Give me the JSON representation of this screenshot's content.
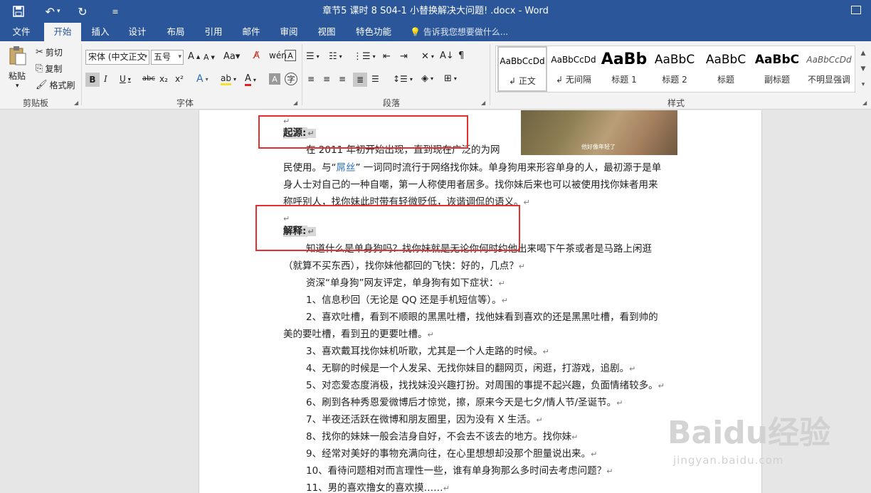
{
  "window": {
    "title": "章节5 课时 8 S04-1 小替换解决大问题! .docx - Word"
  },
  "quick_access": {
    "save_icon": "save-icon",
    "undo_icon": "undo-icon",
    "redo_icon": "redo-icon",
    "customize_icon": "customize-icon"
  },
  "tabs": [
    "文件",
    "开始",
    "插入",
    "设计",
    "布局",
    "引用",
    "邮件",
    "审阅",
    "视图",
    "特色功能"
  ],
  "tell_me": "告诉我您想要做什么...",
  "clipboard": {
    "paste": "粘贴",
    "cut": "剪切",
    "copy": "复制",
    "format_painter": "格式刷",
    "group_label": "剪贴板"
  },
  "font": {
    "font_name": "宋体 (中文正文",
    "font_size": "五号",
    "group_label": "字体"
  },
  "paragraph": {
    "group_label": "段落"
  },
  "styles": {
    "group_label": "样式",
    "items": [
      {
        "sample": "AaBbCcDd",
        "name": "正文"
      },
      {
        "sample": "AaBbCcDd",
        "name": "无间隔"
      },
      {
        "sample": "AaBb",
        "name": "标题 1"
      },
      {
        "sample": "AaBbC",
        "name": "标题 2"
      },
      {
        "sample": "AaBbC",
        "name": "标题"
      },
      {
        "sample": "AaBbC",
        "name": "副标题"
      },
      {
        "sample": "AaBbCcDd",
        "name": "不明显强调"
      }
    ]
  },
  "image": {
    "caption": "他好像年轻了"
  },
  "document": {
    "para_mark": "↵",
    "origin_heading": "起源:",
    "origin_p1": "在 2011 年初开始出现，直到现在广泛的为网",
    "origin_p2_a": "民使用。与“",
    "origin_p2_link": "屌丝",
    "origin_p2_b": "” 一词同时流行于网络找你妹。单身狗用来形容单身的人，最初源于是单",
    "origin_p3": "身人士对自己的一种自嘲，第一人称使用者居多。找你妹后来也可以被使用找你妹者用来",
    "origin_p4": "称呼别人，找你妹此时带有轻微贬低，诙谐调侃的语义。",
    "explain_heading": "解释:",
    "explain_p1": "知道什么是单身狗吗？找你妹就是无论你何时约他出来喝下午茶或者是马路上闲逛",
    "explain_p2": "（就算不买东西），找你妹他都回的飞快：好的，几点？",
    "explain_p3": "资深“单身狗”网友评定，单身狗有如下症状：",
    "items": [
      "1、信息秒回（无论是 QQ 还是手机短信等）。",
      "2、喜欢吐槽，看到不顺眼的黑黑吐槽，找他妹看到喜欢的还是黑黑吐槽，看到帅的",
      "3、喜欢戴耳找你妹机听歌，尤其是一个人走路的时候。",
      "4、无聊的时候是一个人发呆、无找你妹目的翻网页，闲逛，打游戏，追剧。",
      "5、对恋爱态度消极，找找妹没兴趣打扮。对周围的事提不起兴趣，负面情绪较多。",
      "6、刷到各种秀恩爱微博后才惊觉，擦，原来今天是七夕/情人节/圣诞节。",
      "7、半夜还活跃在微博和朋友圈里，因为没有 X 生活。",
      "8、找你的妹妹一般会洁身自好，不会去不该去的地方。找你妹",
      "9、经常对美好的事物充满向往，在心里想想却没那个胆量说出来。",
      "10、看待问题相对而言理性一些，谁有单身狗那么多时间去考虑问题？",
      "11、男的喜欢撸女的喜欢摸……"
    ],
    "item2_cont": "美的要吐槽，看到丑的更要吐槽。"
  },
  "watermark": {
    "main": "Baidu经验",
    "sub": "jingyan.baidu.com"
  },
  "colors": {
    "title_bar": "#2b579a",
    "ribbon": "#f3f3f3",
    "highlight_box": "#e53030"
  }
}
